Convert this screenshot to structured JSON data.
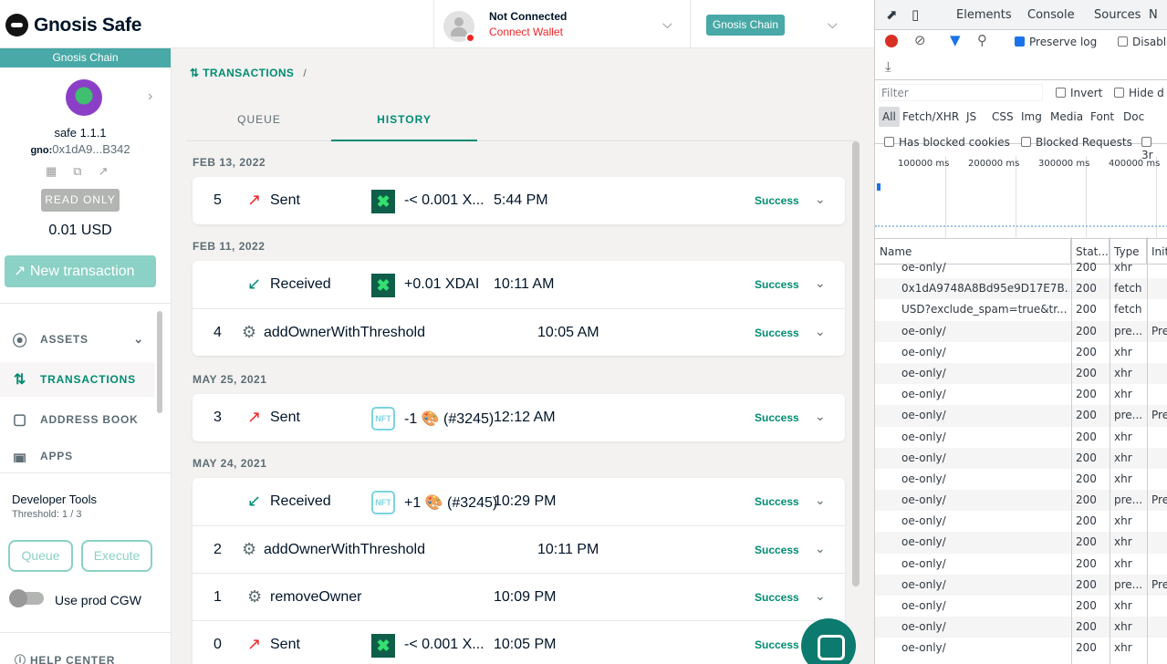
{
  "header": {
    "logo_text": "Gnosis Safe",
    "connection_title": "Not Connected",
    "connection_sub": "Connect Wallet",
    "network": "Gnosis Chain"
  },
  "sidebar": {
    "chain_label": "Gnosis Chain",
    "safe_name": "safe 1.1.1",
    "addr_prefix": "gno:",
    "address": "0x1dA9...B342",
    "read_only": "READ ONLY",
    "balance": "0.01 USD",
    "new_tx": "New transaction",
    "nav": [
      {
        "label": "ASSETS",
        "icon": "coins-icon"
      },
      {
        "label": "TRANSACTIONS",
        "icon": "arrows-updown-icon"
      },
      {
        "label": "ADDRESS BOOK",
        "icon": "book-icon"
      },
      {
        "label": "APPS",
        "icon": "apps-icon"
      }
    ],
    "dev_title": "Developer Tools",
    "threshold": "Threshold: 1 / 3",
    "queue_btn": "Queue",
    "execute_btn": "Execute",
    "toggle_label": "Use prod CGW",
    "help": "HELP CENTER"
  },
  "main": {
    "breadcrumb": "TRANSACTIONS",
    "breadcrumb_sep": "/",
    "tabs": [
      "QUEUE",
      "HISTORY"
    ],
    "groups": [
      {
        "date": "FEB 13, 2022",
        "rows": [
          {
            "nonce": "5",
            "type": "Sent",
            "icon": "arrow-up-right-icon",
            "token": "xdai",
            "amount": "-< 0.001 X...",
            "time": "5:44 PM",
            "status": "Success"
          }
        ]
      },
      {
        "date": "FEB 11, 2022",
        "rows": [
          {
            "nonce": "",
            "type": "Received",
            "icon": "arrow-down-left-icon",
            "token": "xdai",
            "amount": "+0.01 XDAI",
            "time": "10:11 AM",
            "status": "Success"
          },
          {
            "nonce": "4",
            "type": "addOwnerWithThreshold",
            "icon": "gear-icon",
            "token": "",
            "amount": "",
            "time": "10:05 AM",
            "status": "Success"
          }
        ]
      },
      {
        "date": "MAY 25, 2021",
        "rows": [
          {
            "nonce": "3",
            "type": "Sent",
            "icon": "arrow-up-right-icon",
            "token": "nft",
            "amount": "-1 🎨 (#3245)",
            "time": "12:12 AM",
            "status": "Success"
          }
        ]
      },
      {
        "date": "MAY 24, 2021",
        "rows": [
          {
            "nonce": "",
            "type": "Received",
            "icon": "arrow-down-left-icon",
            "token": "nft",
            "amount": "+1 🎨 (#3245)",
            "time": "10:29 PM",
            "status": "Success"
          },
          {
            "nonce": "2",
            "type": "addOwnerWithThreshold",
            "icon": "gear-icon",
            "token": "",
            "amount": "",
            "time": "10:11 PM",
            "status": "Success"
          },
          {
            "nonce": "1",
            "type": "removeOwner",
            "icon": "gear-icon",
            "token": "",
            "amount": "",
            "time": "10:09 PM",
            "status": "Success"
          },
          {
            "nonce": "0",
            "type": "Sent",
            "icon": "arrow-up-right-icon",
            "token": "xdai",
            "amount": "-< 0.001 X...",
            "time": "10:05 PM",
            "status": "Success"
          }
        ]
      }
    ]
  },
  "devtools": {
    "tabs": [
      "Elements",
      "Console",
      "Sources",
      "N"
    ],
    "preserve_log": "Preserve log",
    "disable": "Disabl",
    "filter_placeholder": "Filter",
    "invert": "Invert",
    "hide": "Hide d",
    "types": [
      "All",
      "Fetch/XHR",
      "JS",
      "CSS",
      "Img",
      "Media",
      "Font",
      "Doc"
    ],
    "blocked_cookies": "Has blocked cookies",
    "blocked_requests": "Blocked Requests",
    "third": "3r",
    "ticks": [
      "100000 ms",
      "200000 ms",
      "300000 ms",
      "400000 ms"
    ],
    "columns": [
      "Name",
      "Stat...",
      "Type",
      "Init"
    ],
    "requests": [
      {
        "name": "oe-only/",
        "status": "200",
        "type": "xhr",
        "init": ""
      },
      {
        "name": "0x1dA9748A8Bd95e9D17E7B...",
        "status": "200",
        "type": "fetch",
        "init": ""
      },
      {
        "name": "USD?exclude_spam=true&tr...",
        "status": "200",
        "type": "fetch",
        "init": ""
      },
      {
        "name": "oe-only/",
        "status": "200",
        "type": "pre...",
        "init": "Pre"
      },
      {
        "name": "oe-only/",
        "status": "200",
        "type": "xhr",
        "init": ""
      },
      {
        "name": "oe-only/",
        "status": "200",
        "type": "xhr",
        "init": ""
      },
      {
        "name": "oe-only/",
        "status": "200",
        "type": "xhr",
        "init": ""
      },
      {
        "name": "oe-only/",
        "status": "200",
        "type": "pre...",
        "init": "Pre"
      },
      {
        "name": "oe-only/",
        "status": "200",
        "type": "xhr",
        "init": ""
      },
      {
        "name": "oe-only/",
        "status": "200",
        "type": "xhr",
        "init": ""
      },
      {
        "name": "oe-only/",
        "status": "200",
        "type": "xhr",
        "init": ""
      },
      {
        "name": "oe-only/",
        "status": "200",
        "type": "pre...",
        "init": "Pre"
      },
      {
        "name": "oe-only/",
        "status": "200",
        "type": "xhr",
        "init": ""
      },
      {
        "name": "oe-only/",
        "status": "200",
        "type": "xhr",
        "init": ""
      },
      {
        "name": "oe-only/",
        "status": "200",
        "type": "xhr",
        "init": ""
      },
      {
        "name": "oe-only/",
        "status": "200",
        "type": "pre...",
        "init": "Pre"
      },
      {
        "name": "oe-only/",
        "status": "200",
        "type": "xhr",
        "init": ""
      },
      {
        "name": "oe-only/",
        "status": "200",
        "type": "xhr",
        "init": ""
      },
      {
        "name": "oe-only/",
        "status": "200",
        "type": "xhr",
        "init": ""
      }
    ]
  }
}
